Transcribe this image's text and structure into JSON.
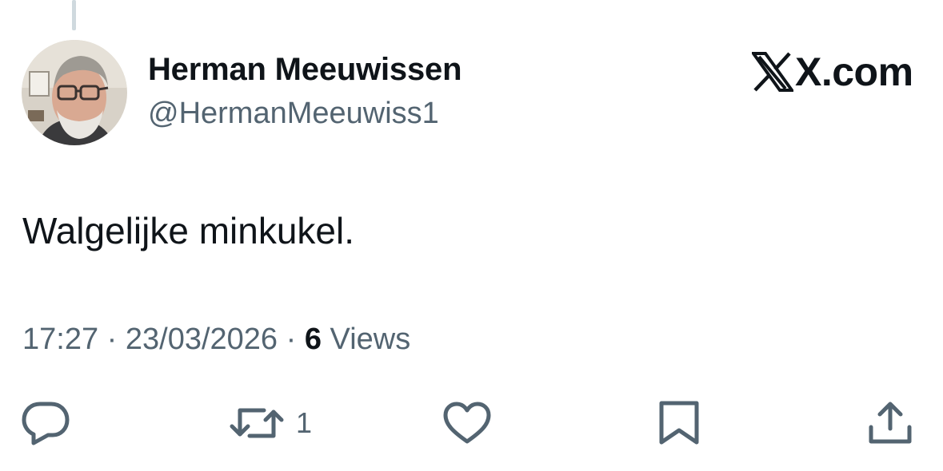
{
  "tweet": {
    "author": {
      "display_name": "Herman Meeuwissen",
      "handle": "@HermanMeeuwiss1"
    },
    "brand": "X.com",
    "text": "Walgelijke minkukel.",
    "time": "17:27",
    "separator": "·",
    "date": "23/03/2026",
    "views_count": "6",
    "views_label": "Views"
  },
  "actions": {
    "reply": {
      "icon": "reply-icon"
    },
    "repost": {
      "icon": "repost-icon",
      "count": "1"
    },
    "like": {
      "icon": "heart-icon"
    },
    "bookmark": {
      "icon": "bookmark-icon"
    },
    "share": {
      "icon": "share-icon"
    }
  },
  "colors": {
    "text": "#0f1419",
    "secondary": "#536471",
    "thread_line": "#cfd9de",
    "background": "#ffffff"
  }
}
